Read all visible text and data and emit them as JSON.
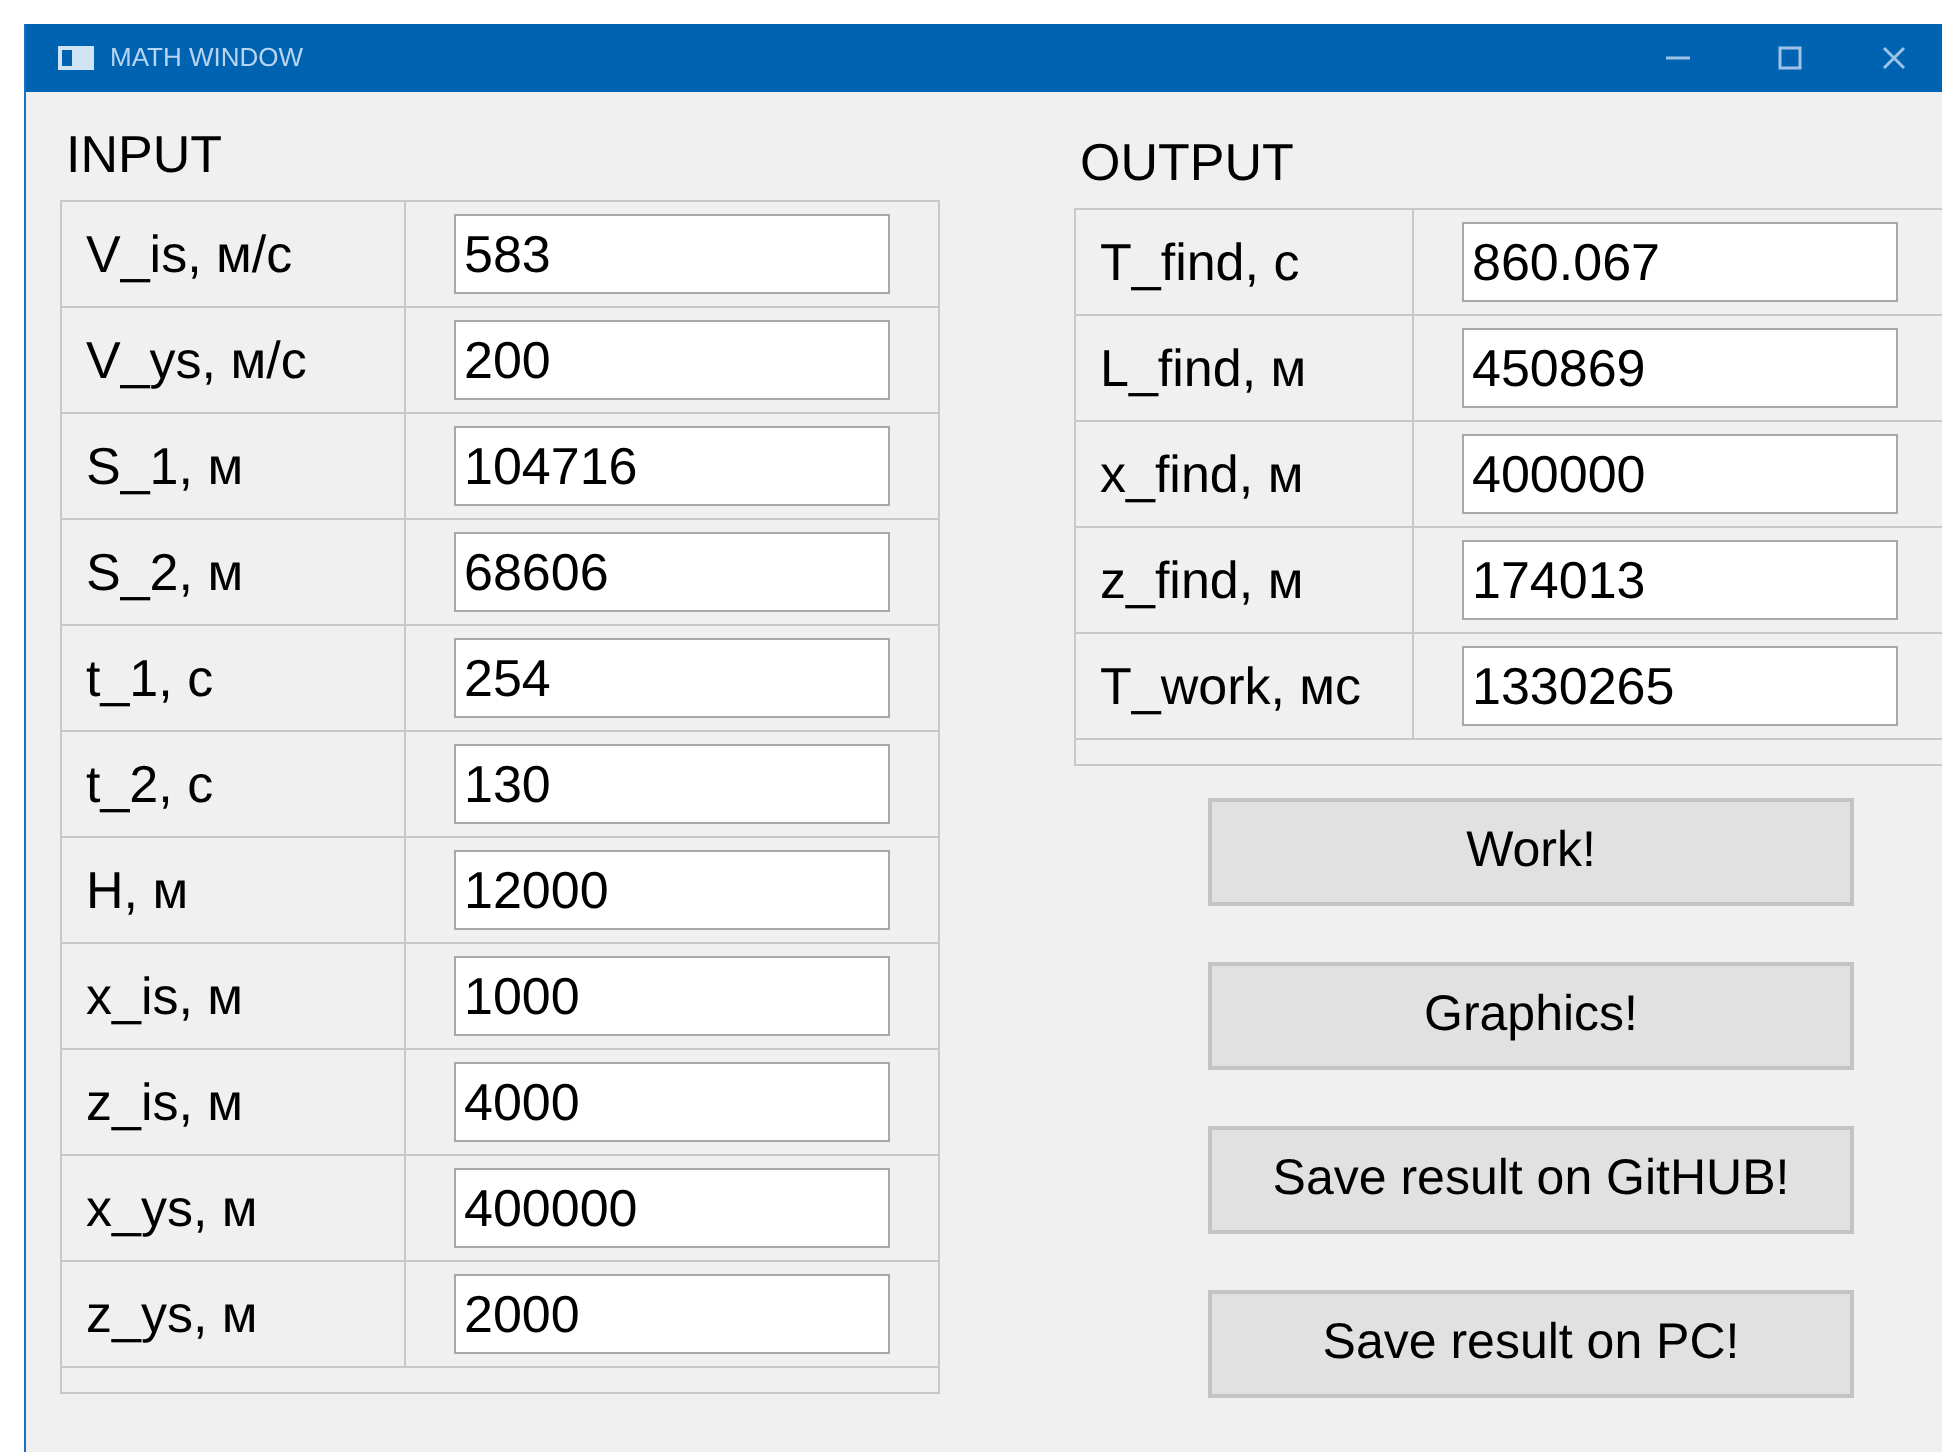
{
  "window": {
    "title": "MATH WINDOW"
  },
  "input": {
    "heading": "INPUT",
    "rows": [
      {
        "label": "V_is, м/с",
        "value": "583"
      },
      {
        "label": "V_ys, м/с",
        "value": "200"
      },
      {
        "label": "S_1, м",
        "value": "104716"
      },
      {
        "label": "S_2, м",
        "value": "68606"
      },
      {
        "label": "t_1, с",
        "value": "254"
      },
      {
        "label": "t_2, с",
        "value": "130"
      },
      {
        "label": "H, м",
        "value": "12000"
      },
      {
        "label": "x_is, м",
        "value": "1000"
      },
      {
        "label": "z_is, м",
        "value": "4000"
      },
      {
        "label": "x_ys, м",
        "value": "400000"
      },
      {
        "label": "z_ys, м",
        "value": "2000"
      }
    ]
  },
  "output": {
    "heading": "OUTPUT",
    "rows": [
      {
        "label": "T_find, с",
        "value": "860.067"
      },
      {
        "label": "L_find, м",
        "value": "450869"
      },
      {
        "label": "x_find, м",
        "value": "400000"
      },
      {
        "label": "z_find, м",
        "value": "174013"
      },
      {
        "label": "T_work, мс",
        "value": "1330265"
      }
    ]
  },
  "buttons": [
    "Work!",
    "Graphics!",
    "Save result on GitHUB!",
    "Save result on PC!"
  ]
}
